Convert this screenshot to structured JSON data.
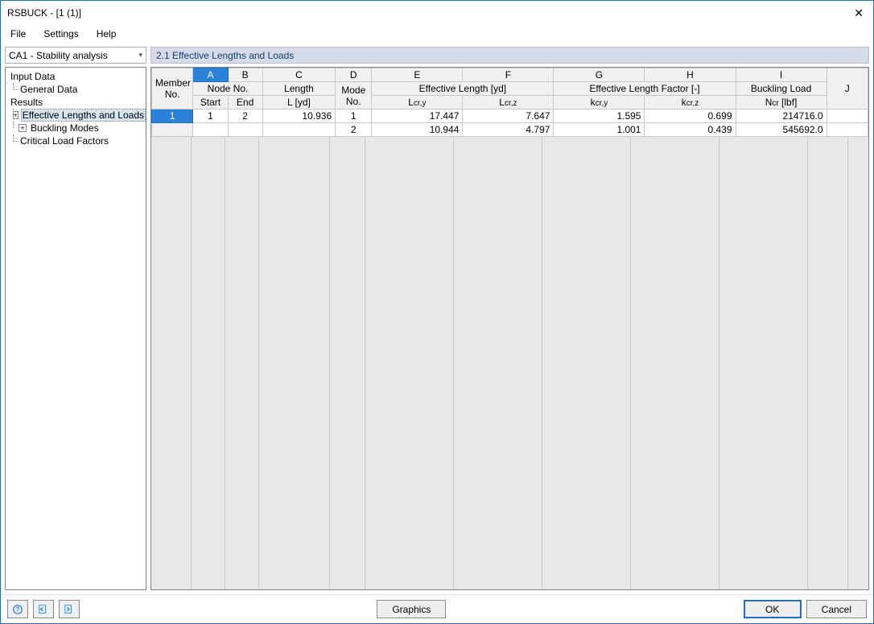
{
  "window": {
    "title": "RSBUCK - [1 (1)]"
  },
  "menu": {
    "file": "File",
    "settings": "Settings",
    "help": "Help"
  },
  "sidebar": {
    "dropdown": "CA1 - Stability analysis",
    "input_data": "Input Data",
    "general_data": "General Data",
    "results": "Results",
    "eff_lengths": "Effective Lengths and Loads",
    "buckling_modes": "Buckling Modes",
    "critical_load_factors": "Critical Load Factors"
  },
  "panel": {
    "title": "2.1 Effective Lengths and Loads"
  },
  "cols": {
    "member_no": "Member\nNo.",
    "A": "A",
    "B": "B",
    "C": "C",
    "D": "D",
    "E": "E",
    "F": "F",
    "G": "G",
    "H": "H",
    "I": "I",
    "J": "J",
    "node_no": "Node No.",
    "start": "Start",
    "end": "End",
    "length": "Length",
    "l_yd": "L [yd]",
    "mode_no": "Mode\nNo.",
    "eff_len": "Effective Length [yd]",
    "lcr_y": "Lcr,y",
    "lcr_z": "Lcr,z",
    "eff_len_factor": "Effective Length Factor [-]",
    "kcr_y": "kcr,y",
    "kcr_z": "kcr,z",
    "buckling_load": "Buckling Load",
    "ncr": "Ncr [lbf]"
  },
  "rows": [
    {
      "member": "1",
      "start": "1",
      "end": "2",
      "L": "10.936",
      "mode": "1",
      "lcry": "17.447",
      "lcrz": "7.647",
      "kcry": "1.595",
      "kcrz": "0.699",
      "ncr": "214716.0"
    },
    {
      "member": "",
      "start": "",
      "end": "",
      "L": "",
      "mode": "2",
      "lcry": "10.944",
      "lcrz": "4.797",
      "kcry": "1.001",
      "kcrz": "0.439",
      "ncr": "545692.0"
    }
  ],
  "footer": {
    "graphics": "Graphics",
    "ok": "OK",
    "cancel": "Cancel"
  }
}
